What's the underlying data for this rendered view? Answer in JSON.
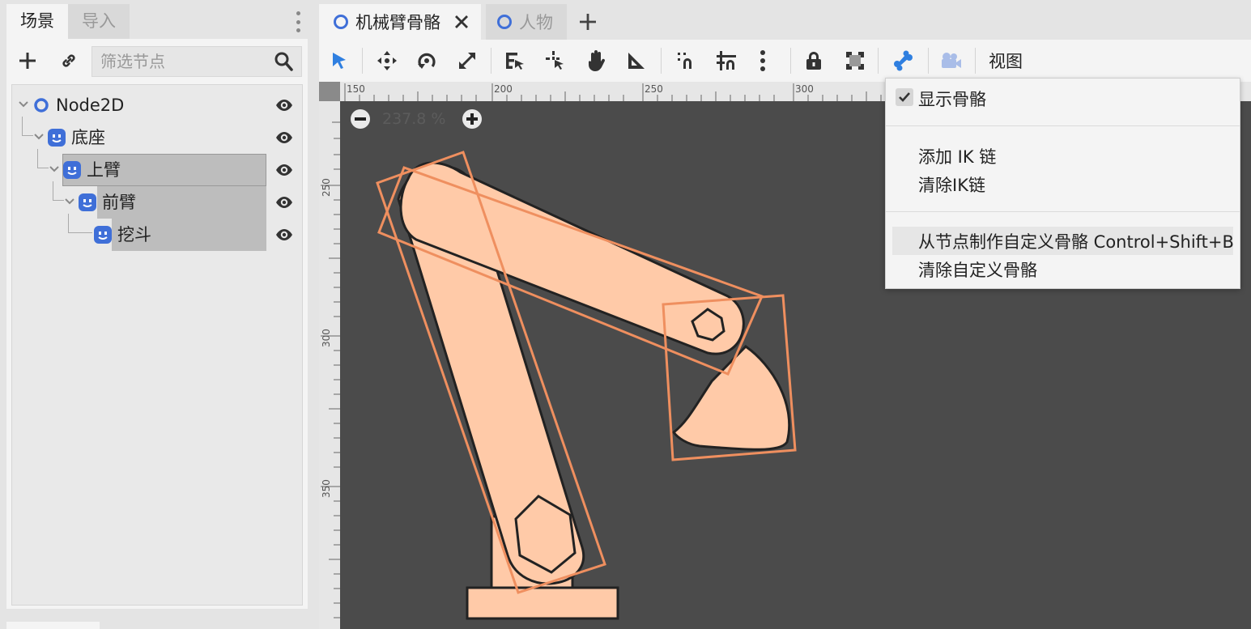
{
  "left_dock": {
    "tabs": [
      {
        "label": "场景",
        "active": true
      },
      {
        "label": "导入",
        "active": false
      }
    ],
    "filter_placeholder": "筛选节点",
    "tree": [
      {
        "name": "Node2D",
        "type": "node2d",
        "depth": 0
      },
      {
        "name": "底座",
        "type": "bone",
        "depth": 1
      },
      {
        "name": "上臂",
        "type": "bone",
        "depth": 2,
        "selected": true
      },
      {
        "name": "前臂",
        "type": "bone",
        "depth": 3,
        "selected": true
      },
      {
        "name": "挖斗",
        "type": "bone",
        "depth": 4,
        "selected": true
      }
    ]
  },
  "editor_tabs": [
    {
      "label": "机械臂骨骼",
      "active": true
    },
    {
      "label": "人物",
      "active": false
    }
  ],
  "toolbar": {
    "view_label": "视图",
    "tools": [
      "select-icon",
      "move-icon",
      "rotate-icon",
      "scale-icon",
      "list-select-icon",
      "pivot-icon",
      "pan-icon",
      "ruler-icon",
      "smart-snap-icon",
      "grid-snap-icon",
      "more-icon",
      "lock-icon",
      "group-icon",
      "bone-icon",
      "camera-icon"
    ]
  },
  "viewport": {
    "zoom": "237.8 %",
    "ruler_top_labels": [
      "150",
      "200",
      "250",
      "300"
    ],
    "ruler_left_labels": [
      "250",
      "300",
      "350"
    ]
  },
  "popup_menu": {
    "show_bones_label": "显示骨骼",
    "show_bones_checked": true,
    "add_ik_label": "添加 IK 链",
    "clear_ik_label": "清除IK链",
    "make_bones_label": "从节点制作自定义骨骼 Control+Shift+B",
    "clear_bones_label": "清除自定义骨骼"
  },
  "colors": {
    "accent": "#3f6fd8",
    "bone_fill": "#ffcaa8",
    "bone_outline": "#ef8f5f",
    "viewport_bg": "#4b4b4b",
    "bone_tool_active": "#2f7fe0"
  }
}
